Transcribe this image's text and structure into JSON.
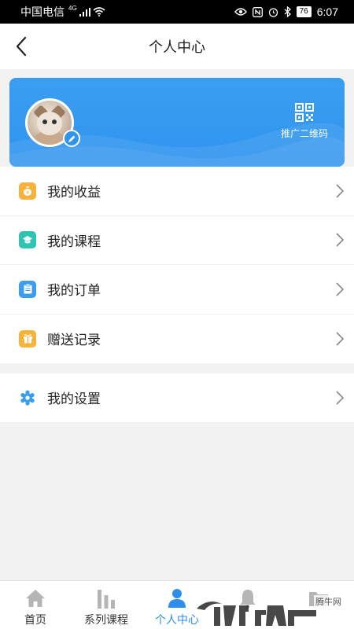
{
  "status_bar": {
    "carrier": "中国电信",
    "network": "4G",
    "battery": "76",
    "time": "6:07"
  },
  "nav": {
    "title": "个人中心"
  },
  "profile": {
    "qr_label": "推广二维码"
  },
  "menu_main": [
    {
      "label": "我的收益",
      "icon": "money-bag-icon",
      "color": "#f7b23b"
    },
    {
      "label": "我的课程",
      "icon": "course-cap-icon",
      "color": "#2fc4b2"
    },
    {
      "label": "我的订单",
      "icon": "order-clipboard-icon",
      "color": "#3a9ef0"
    },
    {
      "label": "赠送记录",
      "icon": "gift-icon",
      "color": "#f7b23b"
    }
  ],
  "menu_settings": [
    {
      "label": "我的设置",
      "icon": "gear-icon",
      "color": "#3a9ef0"
    }
  ],
  "tabs": [
    {
      "label": "首页",
      "icon": "home-icon"
    },
    {
      "label": "系列课程",
      "icon": "bars-icon"
    },
    {
      "label": "个人中心",
      "icon": "person-icon",
      "active": true
    },
    {
      "label": "",
      "icon": "bell-icon"
    },
    {
      "label": "",
      "icon": "folder-icon"
    }
  ],
  "watermark": {
    "text": "腾牛网"
  },
  "colors": {
    "accent": "#2d8fea",
    "card": "#3a9ef0",
    "background": "#f2f2f2"
  }
}
